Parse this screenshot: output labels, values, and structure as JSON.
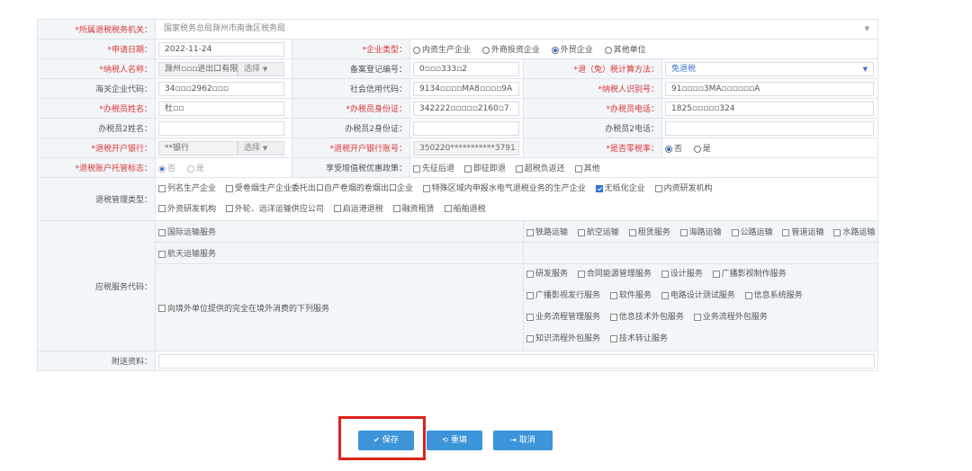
{
  "form": {
    "tax_authority": {
      "label": "*所属退税税务机关：",
      "value": "国家税务总局滁州市南谯区税务局"
    },
    "apply_date": {
      "label": "*申请日期：",
      "value": "2022-11-24"
    },
    "enterprise_type": {
      "label": "*企业类型：",
      "options": [
        "内资生产企业",
        "外商投资企业",
        "外贸企业",
        "其他单位"
      ],
      "selected": "外贸企业"
    },
    "taxpayer_name": {
      "label": "*纳税人名称：",
      "value": "滁州▫▫▫进出口有限▫",
      "picker": "选择"
    },
    "record_no": {
      "label": "备案登记编号：",
      "value": "0▫▫▫333▫2"
    },
    "calc_method": {
      "label": "*退（免）税计算方法：",
      "value": "免退税"
    },
    "customs_code": {
      "label": "海关企业代码：",
      "value": "34▫▫▫2962▫▫▫"
    },
    "credit_code": {
      "label": "社会信用代码：",
      "value": "9134▫▫▫▫MA8▫▫▫▫9A"
    },
    "taxpayer_id": {
      "label": "*纳税人识别号：",
      "value": "91▫▫▫▫3MA▫▫▫▫▫▫A"
    },
    "handler_name": {
      "label": "*办税员姓名：",
      "value": "杜▫▫"
    },
    "handler_id": {
      "label": "*办税员身份证：",
      "value": "342222▫▫▫▫▫2160▫7"
    },
    "handler_phone": {
      "label": "*办税员电话：",
      "value": "1825▫▫▫▫▫324"
    },
    "handler2_name": {
      "label": "办税员2姓名：",
      "value": ""
    },
    "handler2_id": {
      "label": "办税员2身份证：",
      "value": ""
    },
    "handler2_phone": {
      "label": "办税员2电话：",
      "value": ""
    },
    "bank": {
      "label": "*退税开户银行：",
      "value": "**银行",
      "picker": "选择"
    },
    "bank_account": {
      "label": "*退税开户银行账号：",
      "value": "350220***********3791"
    },
    "zero_rate": {
      "label": "*是否零税率：",
      "options": [
        "否",
        "是"
      ],
      "selected": "否"
    },
    "trust_flag": {
      "label": "*退税账户托管标志：",
      "options": [
        "否",
        "是"
      ],
      "selected": "否"
    },
    "vat_policy": {
      "label": "享受增值税优惠政策：",
      "options": [
        "先征后退",
        "即征即退",
        "超税负返还",
        "其他"
      ]
    },
    "mgmt_type": {
      "label": "退税管理类型：",
      "row1": [
        {
          "text": "列名生产企业",
          "checked": false
        },
        {
          "text": "受卷烟生产企业委托出口自产卷烟的卷烟出口企业",
          "checked": false
        },
        {
          "text": "特殊区域内申报水电气退税业务的生产企业",
          "checked": false
        },
        {
          "text": "无纸化企业",
          "checked": true
        },
        {
          "text": "内资研发机构",
          "checked": false
        }
      ],
      "row2": [
        {
          "text": "外资研发机构",
          "checked": false
        },
        {
          "text": "外轮、远洋运输供应公司",
          "checked": false
        },
        {
          "text": "启运港退税",
          "checked": false
        },
        {
          "text": "融资租赁",
          "checked": false
        },
        {
          "text": "船舶退税",
          "checked": false
        }
      ]
    },
    "service_codes": {
      "label": "应税服务代码：",
      "intl_transport": "国际运输服务",
      "transport_types": [
        "铁路运输",
        "航空运输",
        "租赁服务",
        "海路运输",
        "公路运输",
        "管道运输",
        "水路运输"
      ],
      "space_transport": "航天运输服务",
      "overseas": "向境外单位提供的完全在境外消费的下列服务",
      "overseas_lines": [
        [
          "研发服务",
          "合同能源管理服务",
          "设计服务",
          "广播影视制作服务"
        ],
        [
          "广播影视发行服务",
          "软件服务",
          "电路设计测试服务",
          "信息系统服务"
        ],
        [
          "业务流程管理服务",
          "信息技术外包服务",
          "业务流程外包服务"
        ],
        [
          "知识流程外包服务",
          "技术转让服务"
        ]
      ]
    },
    "attachments": {
      "label": "附送资料：",
      "value": ""
    }
  },
  "buttons": {
    "save": "保存",
    "reset": "重填",
    "cancel": "取消"
  },
  "colors": {
    "accent": "#3c95d9",
    "required": "#d33333",
    "highlight": "#e0221d"
  }
}
